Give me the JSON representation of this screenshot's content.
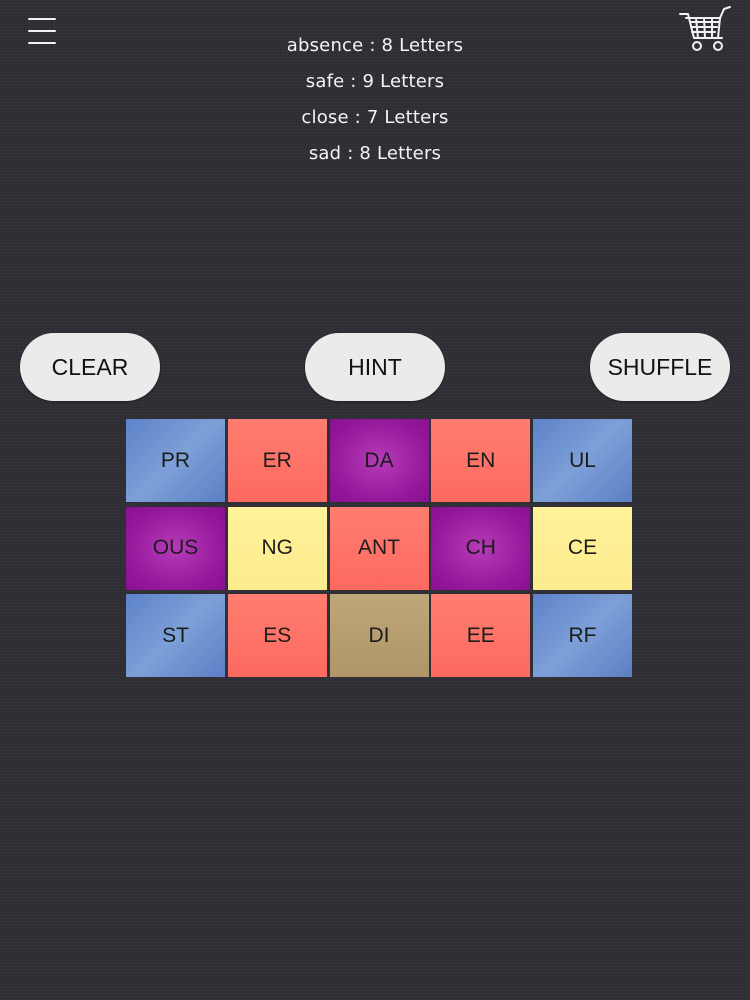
{
  "header": {
    "menu_icon": "hamburger-menu-icon",
    "cart_icon": "shopping-cart-icon"
  },
  "clues": [
    "absence : 8 Letters",
    "safe : 9 Letters",
    "close : 7 Letters",
    "sad : 8 Letters"
  ],
  "buttons": {
    "clear": "CLEAR",
    "hint": "HINT",
    "shuffle": "SHUFFLE"
  },
  "tiles": [
    [
      {
        "text": "PR",
        "color": "blue"
      },
      {
        "text": "ER",
        "color": "red"
      },
      {
        "text": "DA",
        "color": "purple"
      },
      {
        "text": "EN",
        "color": "red"
      },
      {
        "text": "UL",
        "color": "blue"
      }
    ],
    [
      {
        "text": "OUS",
        "color": "purple"
      },
      {
        "text": "NG",
        "color": "yellow"
      },
      {
        "text": "ANT",
        "color": "red"
      },
      {
        "text": "CH",
        "color": "purple"
      },
      {
        "text": "CE",
        "color": "yellow"
      }
    ],
    [
      {
        "text": "ST",
        "color": "blue"
      },
      {
        "text": "ES",
        "color": "red"
      },
      {
        "text": "DI",
        "color": "tan"
      },
      {
        "text": "EE",
        "color": "red"
      },
      {
        "text": "RF",
        "color": "blue"
      }
    ]
  ],
  "colors": {
    "blue": "#6a8fd0",
    "red": "#fd6f64",
    "purple": "#9a1f9e",
    "yellow": "#fdee93",
    "tan": "#b49d6f",
    "background": "#2f2f35"
  }
}
